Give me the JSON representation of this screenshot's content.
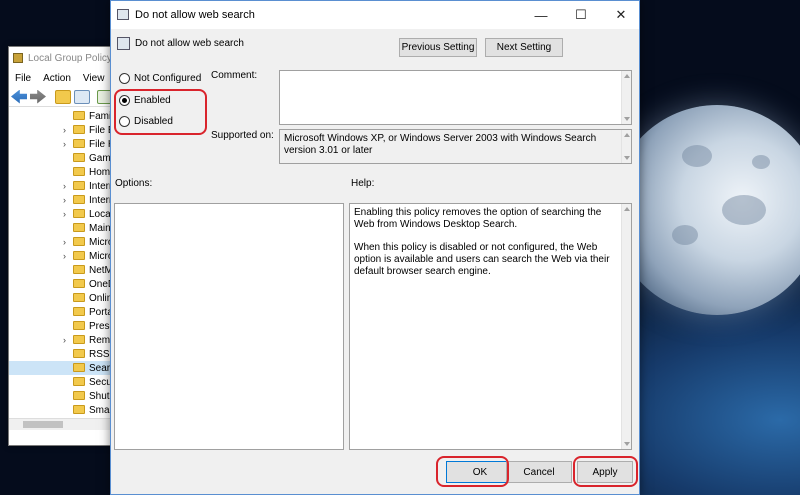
{
  "background_window": {
    "title": "Local Group Policy",
    "menu": [
      "File",
      "Action",
      "View"
    ],
    "tree_items": [
      "Famil",
      "File E",
      "File H",
      "Game",
      "Home",
      "Intern",
      "Intern",
      "Locat",
      "Main",
      "Micro",
      "Micro",
      "NetM",
      "OneD",
      "Onlin",
      "Porta",
      "Prese",
      "Remo",
      "RSS F",
      "Searc",
      "Secur",
      "Shuto",
      "Smar"
    ],
    "selected_index": 18
  },
  "dialog": {
    "title": "Do not allow web search",
    "header": "Do not allow web search",
    "prev_label": "Previous Setting",
    "next_label": "Next Setting",
    "options": [
      {
        "label": "Not Configured",
        "selected": false
      },
      {
        "label": "Enabled",
        "selected": true
      },
      {
        "label": "Disabled",
        "selected": false
      }
    ],
    "comment_label": "Comment:",
    "comment_value": "",
    "supported_label": "Supported on:",
    "supported_text": "Microsoft Windows XP, or Windows Server 2003 with Windows Search version 3.01 or later",
    "options_label": "Options:",
    "help_label": "Help:",
    "help_p1": "Enabling this policy removes the option of searching the Web from Windows Desktop Search.",
    "help_p2": "When this policy is disabled or not configured, the Web option is available and users can search the Web via their default browser search engine.",
    "ok_label": "OK",
    "cancel_label": "Cancel",
    "apply_label": "Apply",
    "window_controls": {
      "minimize": "—",
      "maximize": "☐",
      "close": "✕"
    }
  },
  "colors": {
    "highlight": "#d9242c",
    "accent": "#0078d7"
  }
}
